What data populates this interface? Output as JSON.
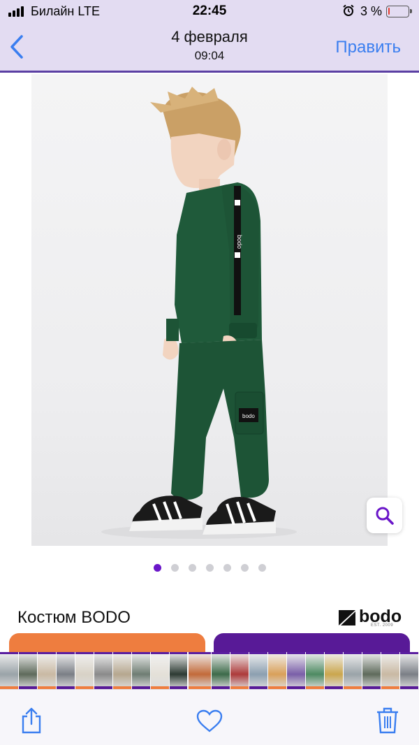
{
  "status_bar": {
    "carrier": "Билайн  LTE",
    "time": "22:45",
    "battery_text": "3 %",
    "battery_level": 0.03
  },
  "nav": {
    "title": "4 февраля",
    "subtitle": "09:04",
    "edit_label": "Править"
  },
  "photo": {
    "icon": "product-photo-boy-green-tracksuit",
    "sleeve_text": "bodo",
    "pocket_patch_text": "bodo"
  },
  "pagination": {
    "count": 7,
    "active_index": 0
  },
  "product": {
    "title": "Костюм BODO",
    "brand_logo_text": "bodo",
    "brand_logo_est": "EST. 2009"
  },
  "colors": {
    "nav_bg": "#e3dcf2",
    "accent_blue": "#3a7ef0",
    "dot_active": "#6a16c9",
    "orange_button": "#ee7d3f",
    "purple_button": "#581a97",
    "tracksuit_green": "#1f5a3a"
  },
  "toolbar": {
    "share_icon": "share-icon",
    "favorite_icon": "heart-icon",
    "delete_icon": "trash-icon"
  }
}
